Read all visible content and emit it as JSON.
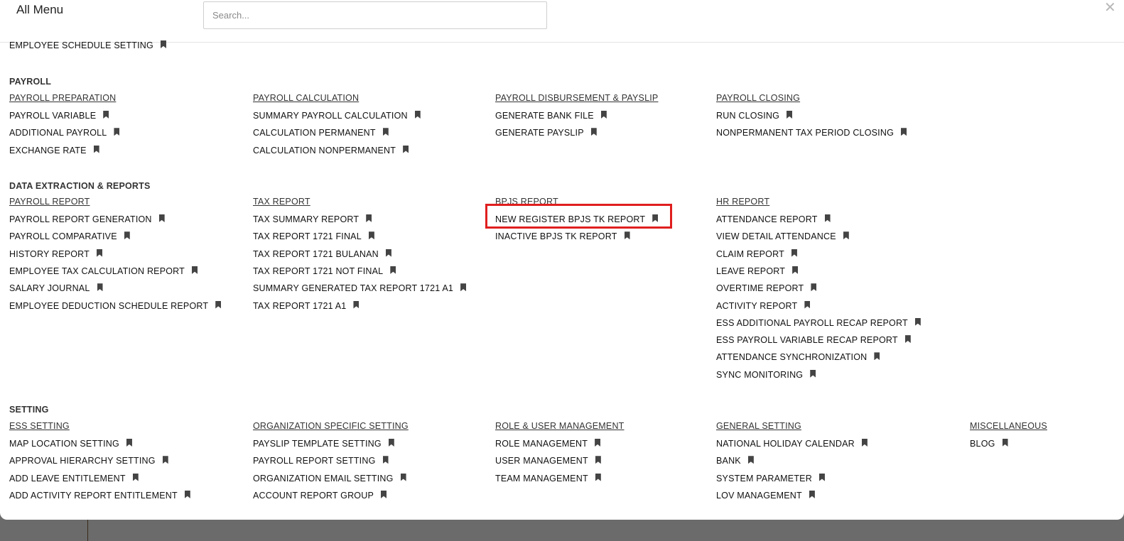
{
  "header": {
    "title": "All Menu",
    "search_placeholder": "Search...",
    "close_symbol": "✕"
  },
  "top_item": {
    "label": "EMPLOYEE SCHEDULE SETTING"
  },
  "sections": {
    "payroll": {
      "title": "PAYROLL",
      "groups": [
        {
          "header": "PAYROLL PREPARATION",
          "items": [
            "PAYROLL VARIABLE",
            "ADDITIONAL PAYROLL",
            "EXCHANGE RATE"
          ]
        },
        {
          "header": "PAYROLL CALCULATION",
          "items": [
            "SUMMARY PAYROLL CALCULATION",
            "CALCULATION PERMANENT",
            "CALCULATION NONPERMANENT"
          ]
        },
        {
          "header": "PAYROLL DISBURSEMENT & PAYSLIP",
          "items": [
            "GENERATE BANK FILE",
            "GENERATE PAYSLIP"
          ]
        },
        {
          "header": "PAYROLL CLOSING",
          "items": [
            "RUN CLOSING",
            "NONPERMANENT TAX PERIOD CLOSING"
          ]
        }
      ]
    },
    "reports": {
      "title": "DATA EXTRACTION & REPORTS",
      "groups": [
        {
          "header": "PAYROLL REPORT",
          "items": [
            "PAYROLL REPORT GENERATION",
            "PAYROLL COMPARATIVE",
            "HISTORY REPORT",
            "EMPLOYEE TAX CALCULATION REPORT",
            "SALARY JOURNAL",
            "EMPLOYEE DEDUCTION SCHEDULE REPORT"
          ]
        },
        {
          "header": "TAX REPORT",
          "items": [
            "TAX SUMMARY REPORT",
            "TAX REPORT 1721 FINAL",
            "TAX REPORT 1721 BULANAN",
            "TAX REPORT 1721 NOT FINAL",
            "SUMMARY GENERATED TAX REPORT 1721 A1",
            "TAX REPORT 1721 A1"
          ]
        },
        {
          "header": "BPJS REPORT",
          "items": [
            "NEW REGISTER BPJS TK REPORT",
            "INACTIVE BPJS TK REPORT"
          ]
        },
        {
          "header": "HR REPORT",
          "items": [
            "ATTENDANCE REPORT",
            "VIEW DETAIL ATTENDANCE",
            "CLAIM REPORT",
            "LEAVE REPORT",
            "OVERTIME REPORT",
            "ACTIVITY REPORT",
            "ESS ADDITIONAL PAYROLL RECAP REPORT",
            "ESS PAYROLL VARIABLE RECAP REPORT",
            "ATTENDANCE SYNCHRONIZATION",
            "SYNC MONITORING"
          ]
        }
      ]
    },
    "setting": {
      "title": "SETTING",
      "groups": [
        {
          "header": "ESS SETTING",
          "items": [
            "MAP LOCATION SETTING",
            "APPROVAL HIERARCHY SETTING",
            "ADD LEAVE ENTITLEMENT",
            "ADD ACTIVITY REPORT ENTITLEMENT"
          ]
        },
        {
          "header": "ORGANIZATION SPECIFIC SETTING",
          "items": [
            "PAYSLIP TEMPLATE SETTING",
            "PAYROLL REPORT SETTING",
            "ORGANIZATION EMAIL SETTING",
            "ACCOUNT REPORT GROUP"
          ]
        },
        {
          "header": "ROLE & USER MANAGEMENT",
          "items": [
            "ROLE MANAGEMENT",
            "USER MANAGEMENT",
            "TEAM MANAGEMENT"
          ]
        },
        {
          "header": "GENERAL SETTING",
          "items": [
            "NATIONAL HOLIDAY CALENDAR",
            "BANK",
            "SYSTEM PARAMETER",
            "LOV MANAGEMENT"
          ]
        },
        {
          "header": "MISCELLANEOUS",
          "items": [
            "BLOG"
          ]
        }
      ]
    }
  },
  "highlighted_item": "NEW REGISTER BPJS TK REPORT",
  "colors": {
    "highlight": "#e01e1e",
    "backdrop": "#6b6b6b",
    "bookmark": "#444444"
  },
  "icons": {
    "item_icon": "bookmark-icon",
    "close": "close-icon"
  }
}
